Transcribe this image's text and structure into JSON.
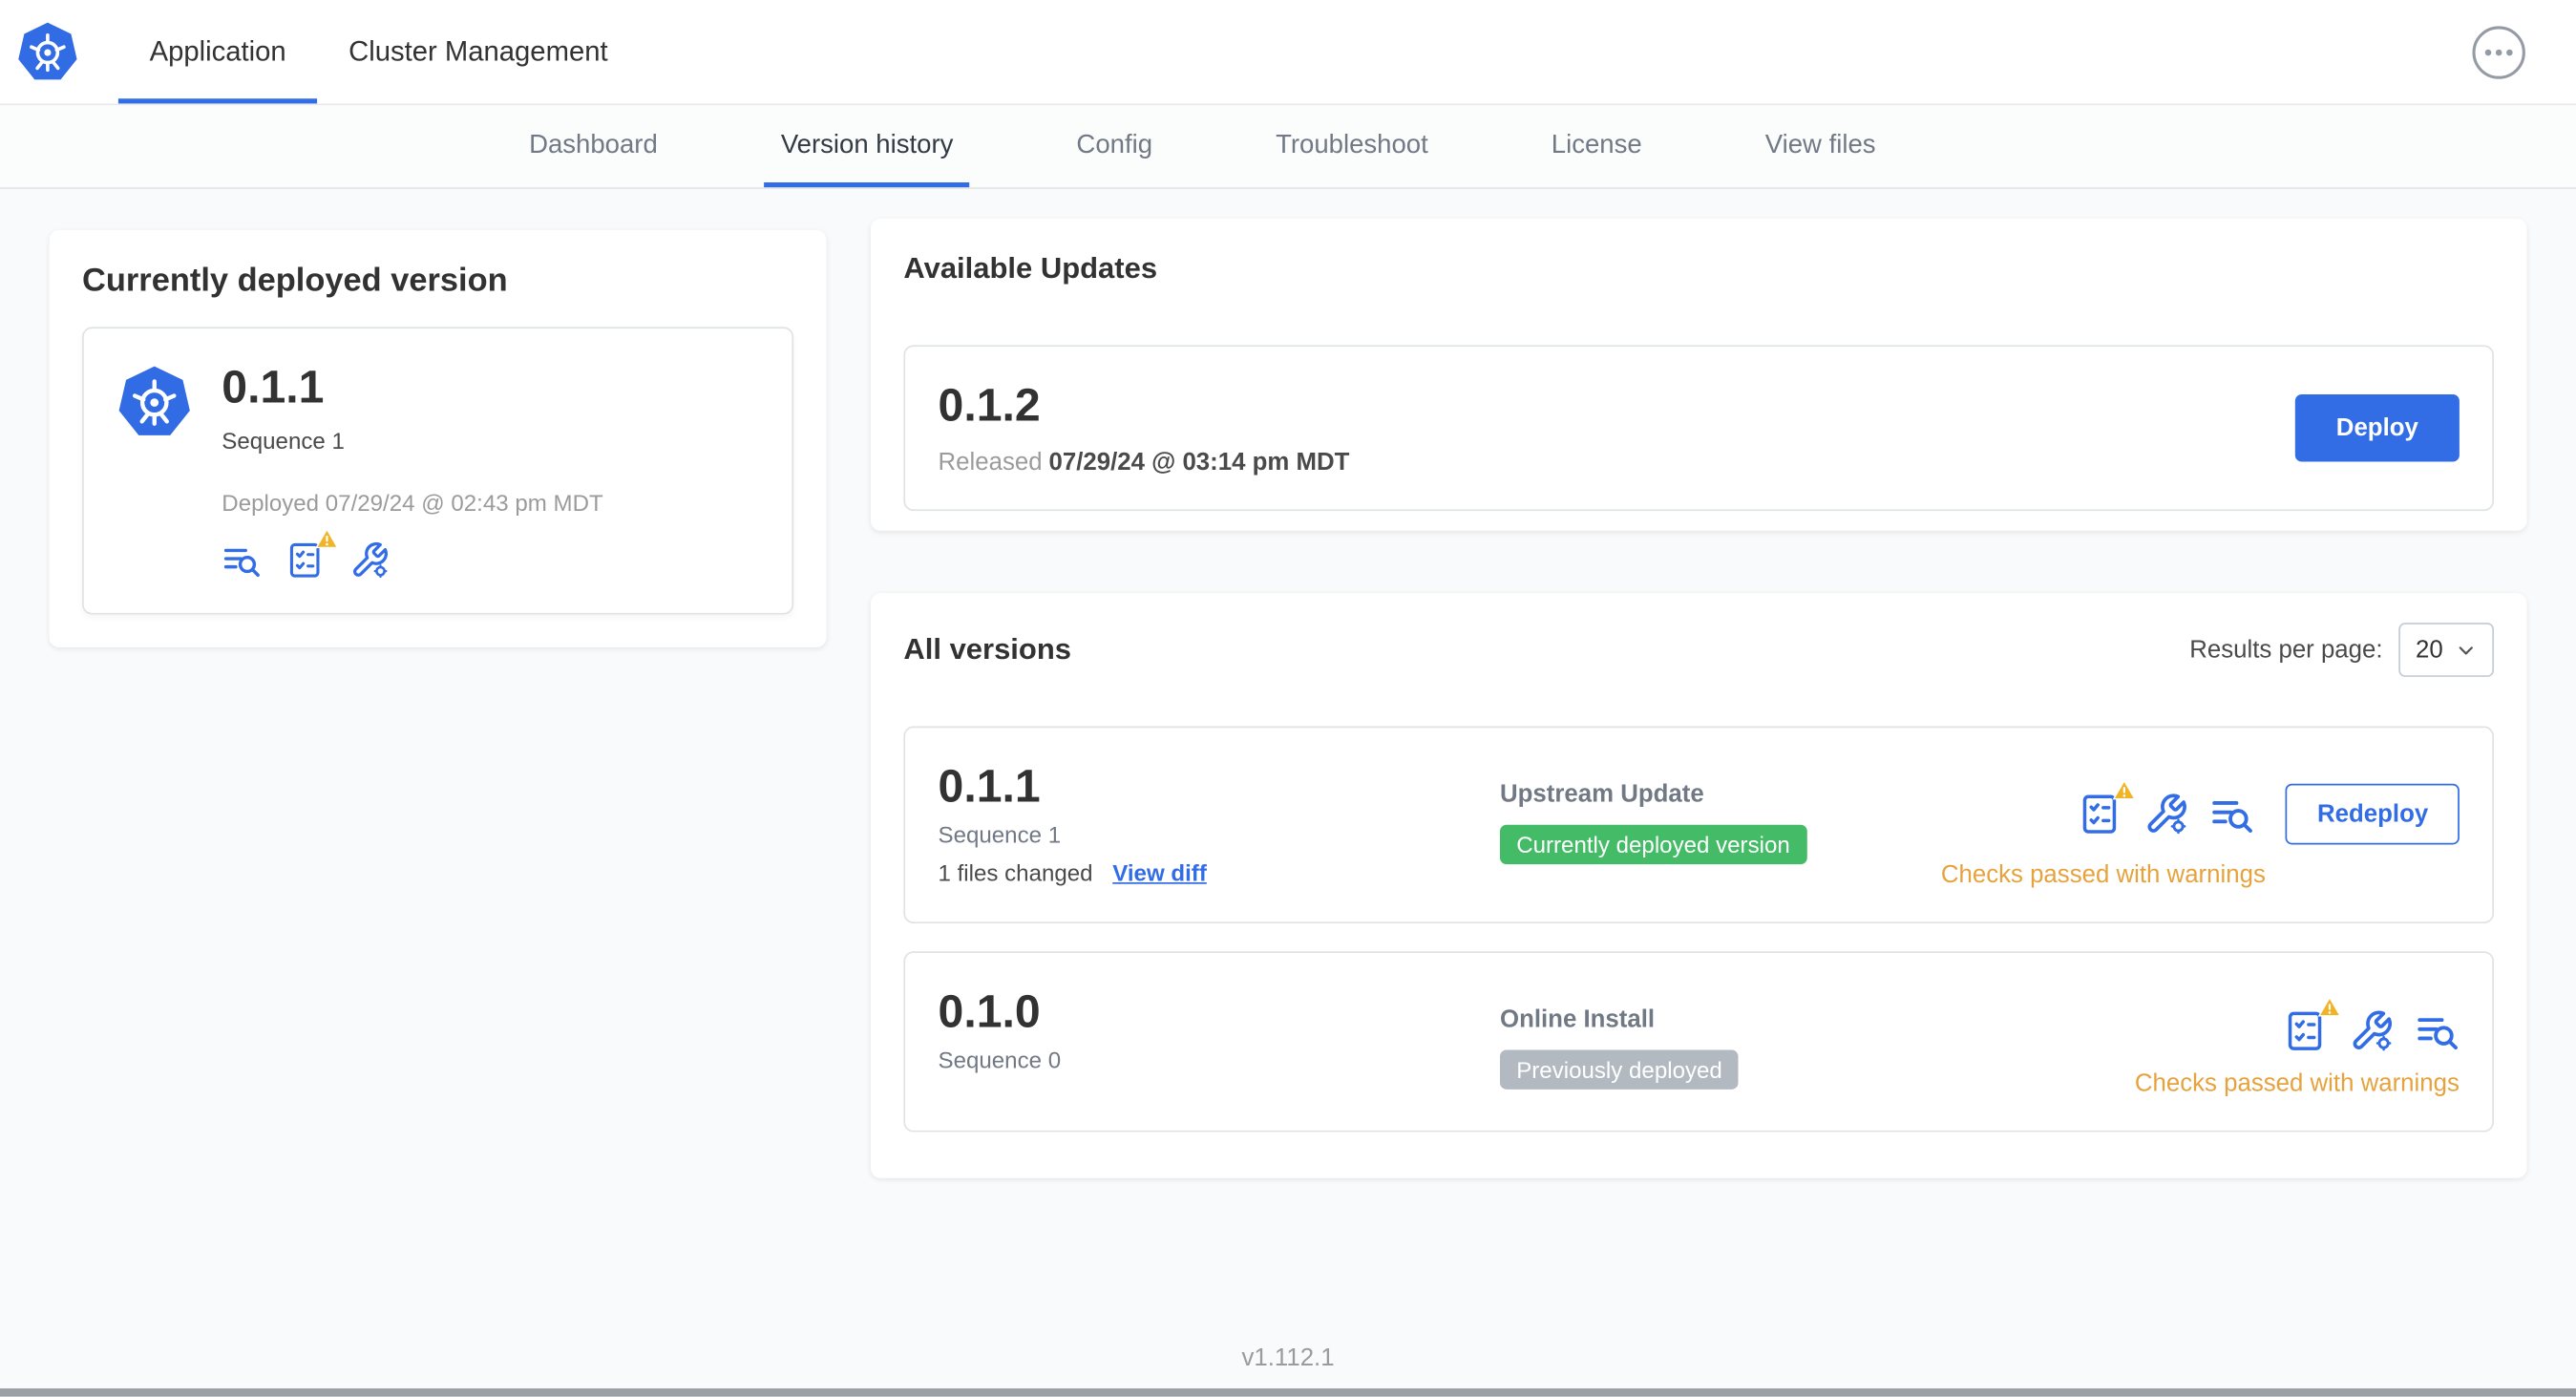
{
  "header": {
    "tabs": [
      {
        "label": "Application"
      },
      {
        "label": "Cluster Management"
      }
    ],
    "active_tab": "Application",
    "overflow_menu_icon": "ellipsis-icon"
  },
  "subnav": {
    "tabs": [
      {
        "label": "Dashboard"
      },
      {
        "label": "Version history"
      },
      {
        "label": "Config"
      },
      {
        "label": "Troubleshoot"
      },
      {
        "label": "License"
      },
      {
        "label": "View files"
      }
    ],
    "active_tab": "Version history"
  },
  "currently_deployed": {
    "title": "Currently deployed version",
    "version": "0.1.1",
    "sequence": "Sequence 1",
    "deployed_text": "Deployed 07/29/24 @ 02:43 pm MDT",
    "icons": [
      "release-notes-icon",
      "preflight-checks-warning-icon",
      "config-icon"
    ]
  },
  "available_updates": {
    "title": "Available Updates",
    "version": "0.1.2",
    "released_prefix": "Released",
    "released_value": "07/29/24 @ 03:14 pm MDT",
    "deploy_button": "Deploy"
  },
  "all_versions": {
    "title": "All versions",
    "results_per_page_label": "Results per page:",
    "results_per_page_value": "20",
    "rows": [
      {
        "version": "0.1.1",
        "sequence": "Sequence 1",
        "files_changed": "1 files changed",
        "view_diff_link": "View diff",
        "source": "Upstream Update",
        "badge_label": "Currently deployed version",
        "badge_color": "#44BB66",
        "status_text": "Checks passed with warnings",
        "action_button": "Redeploy"
      },
      {
        "version": "0.1.0",
        "sequence": "Sequence 0",
        "source": "Online Install",
        "badge_label": "Previously deployed",
        "badge_color": "#B3B9C1",
        "status_text": "Checks passed with warnings"
      }
    ]
  },
  "footer": {
    "app_version": "v1.112.1"
  },
  "colors": {
    "accent_blue": "#326DE6",
    "warning_text": "#E6A23C",
    "warning_triangle": "#F0B429",
    "green_badge": "#44BB66",
    "gray_badge": "#B3B9C1"
  }
}
